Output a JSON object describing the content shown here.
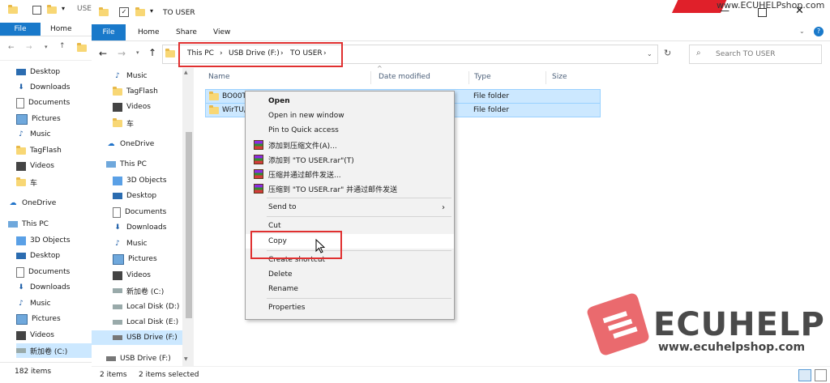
{
  "back_window": {
    "title": "USE",
    "ribbon": {
      "file": "File",
      "home": "Home"
    },
    "nav": [
      "Desktop",
      "Downloads",
      "Documents",
      "Pictures",
      "Music",
      "TagFlash",
      "Videos",
      "车",
      "OneDrive",
      "This PC",
      "3D Objects",
      "Desktop",
      "Documents",
      "Downloads",
      "Music",
      "Pictures",
      "Videos",
      "新加卷 (C:)"
    ],
    "status": "182 items"
  },
  "front_window": {
    "title": "TO USER",
    "ribbon_tabs": {
      "file": "File",
      "home": "Home",
      "share": "Share",
      "view": "View"
    },
    "breadcrumb": [
      "This PC",
      "USB Drive (F:)",
      "TO USER"
    ],
    "search_placeholder": "Search TO USER",
    "nav": {
      "quick": [
        "Music",
        "TagFlash",
        "Videos",
        "车"
      ],
      "onedrive": "OneDrive",
      "thispc": "This PC",
      "pc_items": [
        "3D Objects",
        "Desktop",
        "Documents",
        "Downloads",
        "Music",
        "Pictures",
        "Videos",
        "新加卷 (C:)",
        "Local Disk (D:)",
        "Local Disk (E:)",
        "USB Drive (F:)"
      ],
      "usb": "USB Drive (F:)"
    },
    "columns": {
      "name": "Name",
      "date": "Date modified",
      "type": "Type",
      "size": "Size"
    },
    "rows": [
      {
        "name": "BO00T",
        "type": "File folder"
      },
      {
        "name": "WirTU/",
        "type": "File folder"
      }
    ],
    "status": {
      "items": "2 items",
      "selected": "2 items selected"
    }
  },
  "context_menu": {
    "open": "Open",
    "open_new": "Open in new window",
    "pin": "Pin to Quick access",
    "rar1": "添加到压缩文件(A)...",
    "rar2": "添加到 \"TO USER.rar\"(T)",
    "rar3": "压缩并通过邮件发送...",
    "rar4": "压缩到 \"TO USER.rar\" 并通过邮件发送",
    "send_to": "Send to",
    "cut": "Cut",
    "copy": "Copy",
    "create_shortcut": "Create shortcut",
    "delete": "Delete",
    "rename": "Rename",
    "properties": "Properties"
  },
  "watermark": {
    "brand": "ECUHELP",
    "url": "www.ecuhelpshop.com",
    "top_url": "www.ECUHELPshop.com"
  }
}
